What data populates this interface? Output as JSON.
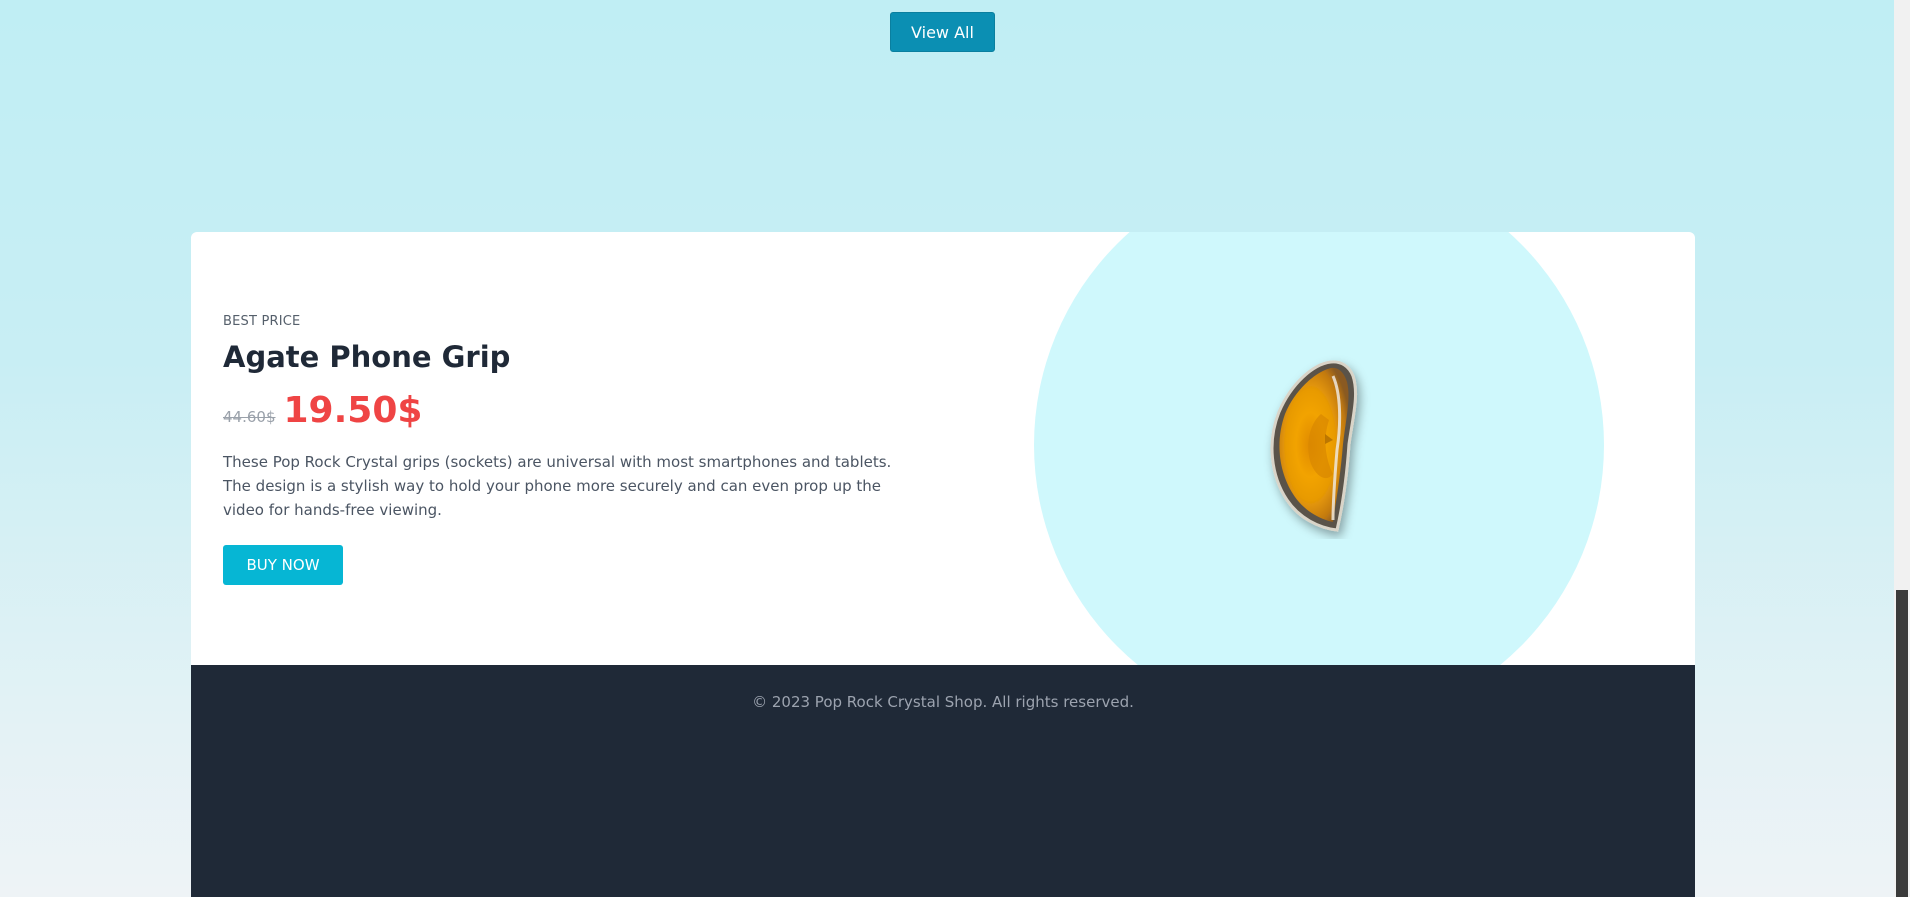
{
  "header": {
    "view_all_label": "View All"
  },
  "promo": {
    "badge": "BEST PRICE",
    "title": "Agate Phone Grip",
    "old_price": "44.60$",
    "new_price": "19.50$",
    "description": "These Pop Rock Crystal grips (sockets) are universal with most smartphones and tablets. The design is a stylish way to hold your phone more securely and can even prop up the video for hands-free viewing.",
    "buy_now_label": "BUY NOW",
    "image_icon": "agate-phone-grip-image"
  },
  "footer": {
    "copyright": "© 2023 Pop Rock Crystal Shop. All rights reserved."
  },
  "colors": {
    "accent": "#06b6d4",
    "view_all_bg": "#0b8fb3",
    "price_red": "#ef4444",
    "footer_bg": "#1f2937",
    "circle_bg": "#cff8fc"
  }
}
